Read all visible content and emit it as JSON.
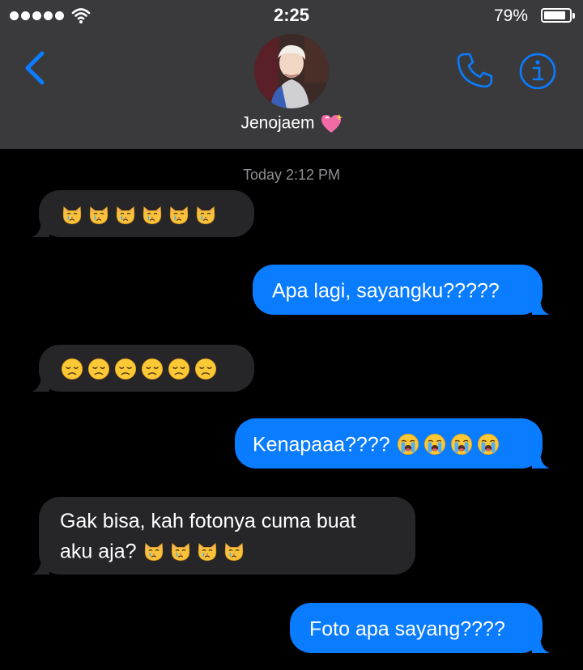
{
  "status_bar": {
    "time": "2:25",
    "battery_pct": "79%"
  },
  "header": {
    "contact_name": "Jenojaem",
    "contact_emoji": "sparkling-heart"
  },
  "thread": {
    "timestamp": "Today 2:12 PM",
    "messages": [
      {
        "dir": "in",
        "text": "",
        "emoji": [
          "crying-cat",
          "crying-cat",
          "crying-cat",
          "crying-cat",
          "crying-cat",
          "crying-cat"
        ]
      },
      {
        "dir": "out",
        "text": "Apa lagi, sayangku?????",
        "emoji": []
      },
      {
        "dir": "in",
        "text": "",
        "emoji": [
          "disappointed-face",
          "disappointed-face",
          "disappointed-face",
          "disappointed-face",
          "disappointed-face",
          "disappointed-face"
        ]
      },
      {
        "dir": "out",
        "text": "Kenapaaa????",
        "emoji": [
          "loudly-crying-face",
          "loudly-crying-face",
          "loudly-crying-face",
          "loudly-crying-face"
        ]
      },
      {
        "dir": "in",
        "text_line1": "Gak bisa, kah fotonya cuma buat",
        "text_line2": "aku aja?",
        "emoji": [
          "crying-cat",
          "crying-cat",
          "crying-cat",
          "crying-cat"
        ]
      },
      {
        "dir": "out",
        "text": "Foto apa sayang????",
        "emoji": []
      }
    ]
  },
  "colors": {
    "accent": "#0a7cff",
    "incoming_bubble": "#262629",
    "header_bg": "#3a3a3c"
  }
}
